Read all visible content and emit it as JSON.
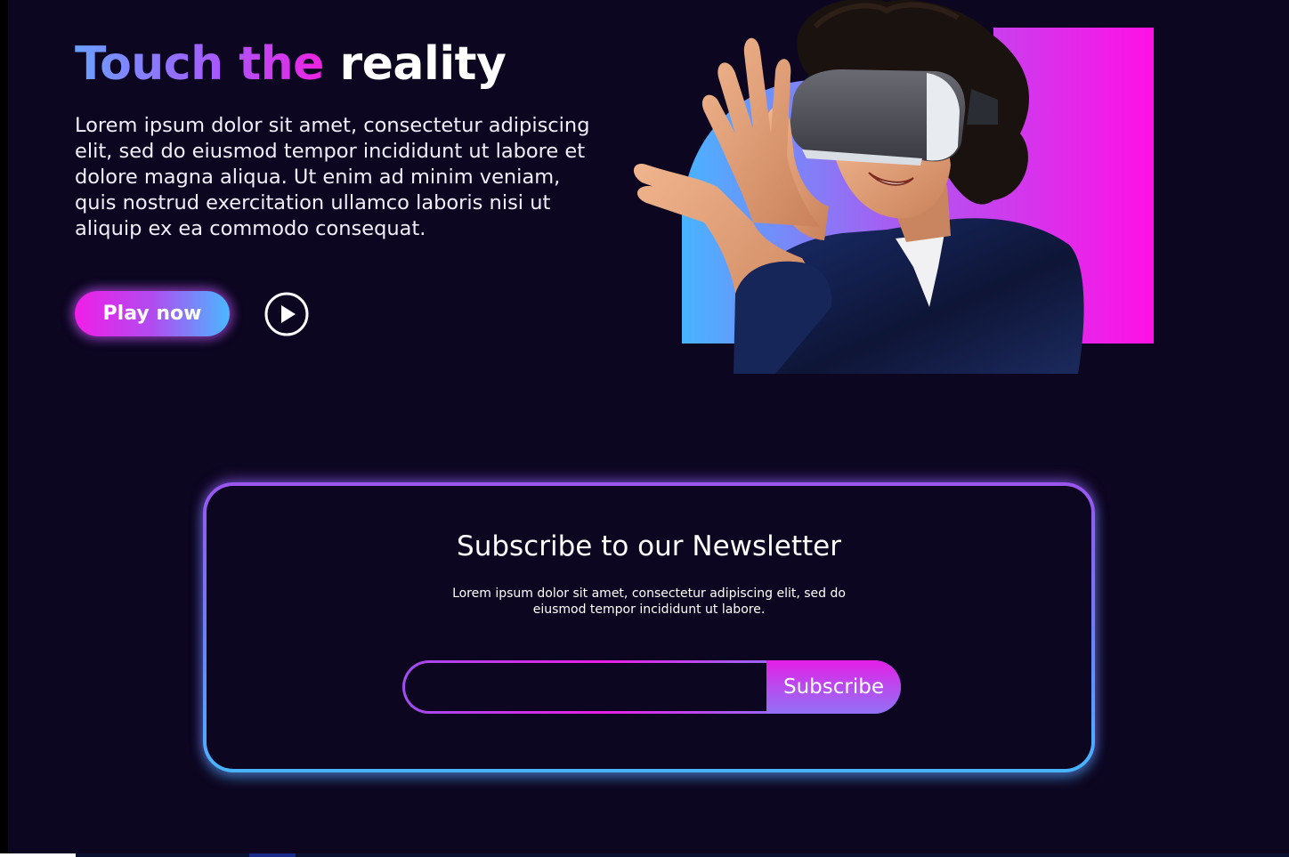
{
  "hero": {
    "title_gradient": "Touch the",
    "title_plain": "reality",
    "description": "Lorem ipsum dolor sit amet, consectetur adipiscing elit, sed do eiusmod tempor incididunt ut labore et dolore magna aliqua. Ut enim ad minim veniam, quis nostrud exercitation ullamco laboris nisi ut aliquip ex ea commodo consequat.",
    "play_button_label": "Play now",
    "play_icon": "play-circle-icon",
    "image_subject": "hero-vr-image"
  },
  "newsletter": {
    "title": "Subscribe to our Newsletter",
    "description": "Lorem ipsum dolor sit amet, consectetur adipiscing elit, sed do eiusmod tempor incididunt ut labore.",
    "email_value": "",
    "subscribe_label": "Subscribe"
  },
  "colors": {
    "background": "#0d0620",
    "accent_magenta": "#f01ee8",
    "accent_purple": "#a35cff",
    "accent_blue": "#4ab8ff"
  }
}
